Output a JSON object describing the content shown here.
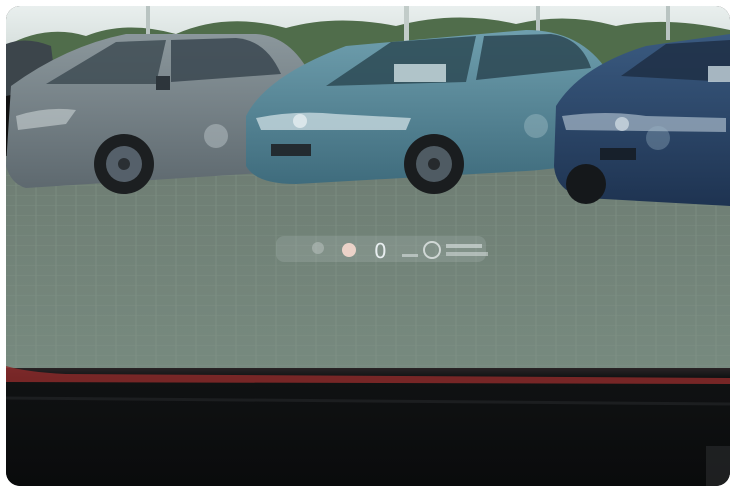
{
  "scene": {
    "description_icon": "windshield-photo",
    "hud": {
      "speed_value": "0"
    },
    "colors": {
      "sky": "#dfe7e6",
      "trees": "#4f6b4a",
      "pavement": "#6f8076",
      "dashboard": "#0d0f10",
      "accent_line": "#8a2a2a",
      "car_gray": "#6f7b82",
      "car_teal": "#4f7f90",
      "car_navy": "#253f63"
    }
  }
}
